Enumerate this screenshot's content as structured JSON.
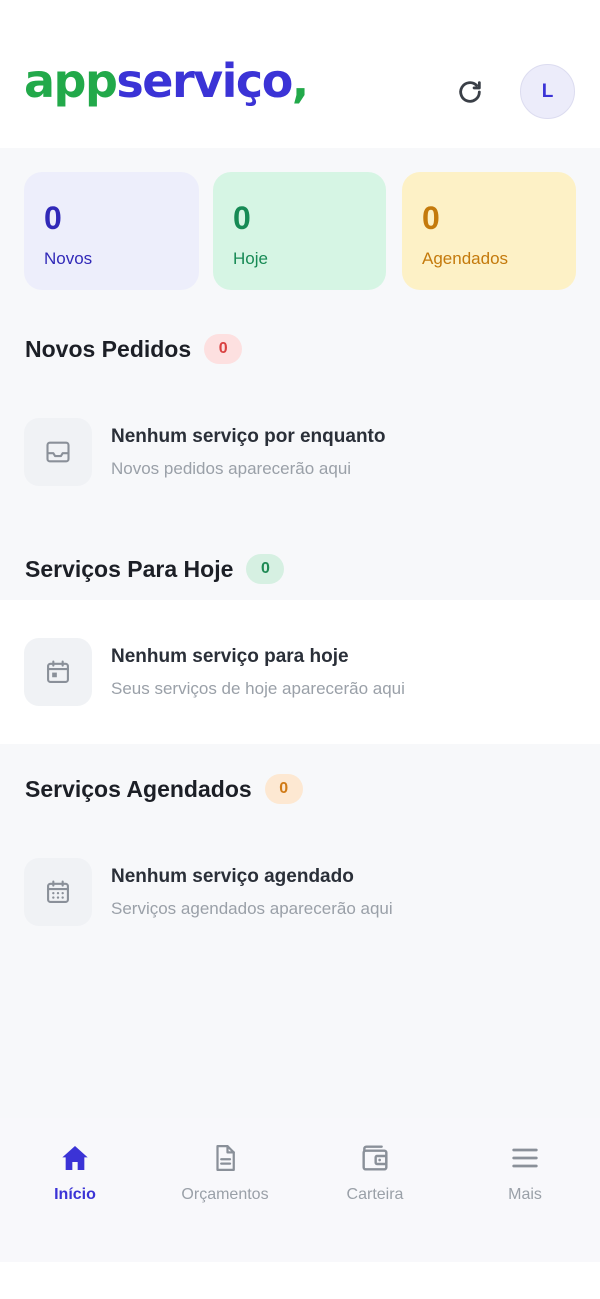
{
  "header": {
    "logo_app": "app",
    "logo_servico": "serviço",
    "logo_comma": ",",
    "avatar_initial": "L",
    "refresh_icon": "refresh-icon"
  },
  "stats": [
    {
      "value": "0",
      "label": "Novos"
    },
    {
      "value": "0",
      "label": "Hoje"
    },
    {
      "value": "0",
      "label": "Agendados"
    }
  ],
  "sections": {
    "novos_pedidos": {
      "title": "Novos Pedidos",
      "count": "0",
      "empty_title": "Nenhum serviço por enquanto",
      "empty_subtitle": "Novos pedidos aparecerão aqui",
      "icon": "inbox-icon"
    },
    "servicos_hoje": {
      "title": "Serviços Para Hoje",
      "count": "0",
      "empty_title": "Nenhum serviço para hoje",
      "empty_subtitle": "Seus serviços de hoje aparecerão aqui",
      "icon": "calendar-day-icon"
    },
    "servicos_agendados": {
      "title": "Serviços Agendados",
      "count": "0",
      "empty_title": "Nenhum serviço agendado",
      "empty_subtitle": "Serviços agendados aparecerão aqui",
      "icon": "calendar-grid-icon"
    }
  },
  "nav": [
    {
      "label": "Início",
      "icon": "home-icon",
      "active": true
    },
    {
      "label": "Orçamentos",
      "icon": "document-icon",
      "active": false
    },
    {
      "label": "Carteira",
      "icon": "wallet-icon",
      "active": false
    },
    {
      "label": "Mais",
      "icon": "menu-icon",
      "active": false
    }
  ],
  "colors": {
    "brand_green": "#22a94a",
    "brand_blue": "#3b33d6",
    "novos_bg": "#edeefb",
    "hoje_bg": "#d6f5e4",
    "agendados_bg": "#fdf1c6"
  }
}
